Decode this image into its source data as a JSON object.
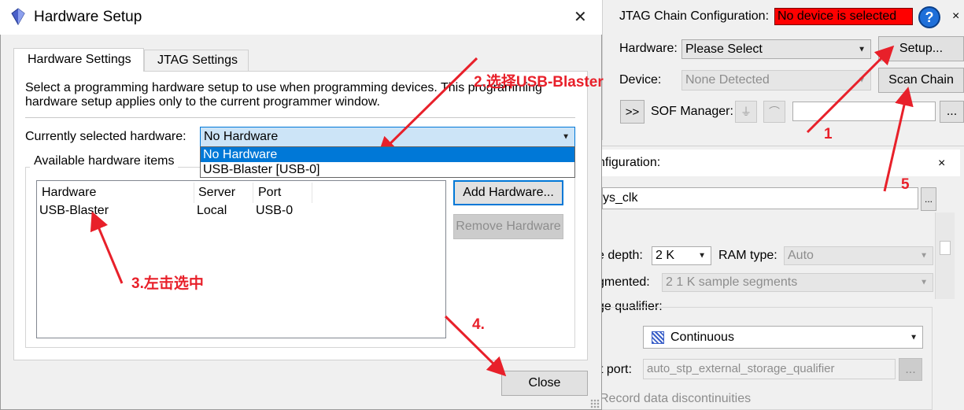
{
  "jtag": {
    "chain_label": "JTAG Chain Configuration:",
    "status": "No device is selected",
    "hardware_label": "Hardware:",
    "hardware_value": "Please Select",
    "setup_label": "Setup...",
    "device_label": "Device:",
    "device_value": "None Detected",
    "scan_label": "Scan Chain",
    "expand_label": ">>",
    "sof_label": "SOF Manager:",
    "browse_label": "...",
    "close_glyph": "×"
  },
  "signal": {
    "title": "nfiguration:",
    "clock_value": "ys_clk",
    "browse_label": "...",
    "close_glyph": "×",
    "depth_label": "e depth:",
    "depth_value": "2 K",
    "ram_label": "RAM type:",
    "ram_value": "Auto",
    "segmented_label": "gmented:",
    "segmented_value": "2  1 K sample segments",
    "qualifier_label": "ge qualifier:",
    "type_label": ":",
    "continuous_value": "Continuous",
    "port_label": "t port:",
    "port_value": "auto_stp_external_storage_qualifier",
    "port_browse": "...",
    "record_label": "Record data discontinuities"
  },
  "dialog": {
    "title": "Hardware Setup",
    "close_glyph": "✕",
    "tabs": [
      "Hardware Settings",
      "JTAG Settings"
    ],
    "description": "Select a programming hardware setup to use when programming devices. This programming hardware setup applies only to the current programmer window.",
    "current_label": "Currently selected hardware:",
    "current_value": "No Hardware",
    "dropdown_options": [
      "No Hardware",
      "USB-Blaster [USB-0]"
    ],
    "available_label": "Available hardware items",
    "columns": [
      "Hardware",
      "Server",
      "Port"
    ],
    "rows": [
      [
        "USB-Blaster",
        "Local",
        "USB-0"
      ]
    ],
    "add_label": "Add Hardware...",
    "remove_label": "Remove Hardware",
    "close_label": "Close"
  },
  "annotations": {
    "step1": "1",
    "step2": "2.选择USB-Blaster",
    "step3": "3.左击选中",
    "step4": "4.",
    "step5": "5"
  },
  "colors": {
    "status_bg": "#ff0000",
    "annotation": "#e8202a",
    "selection": "#0078d7"
  }
}
